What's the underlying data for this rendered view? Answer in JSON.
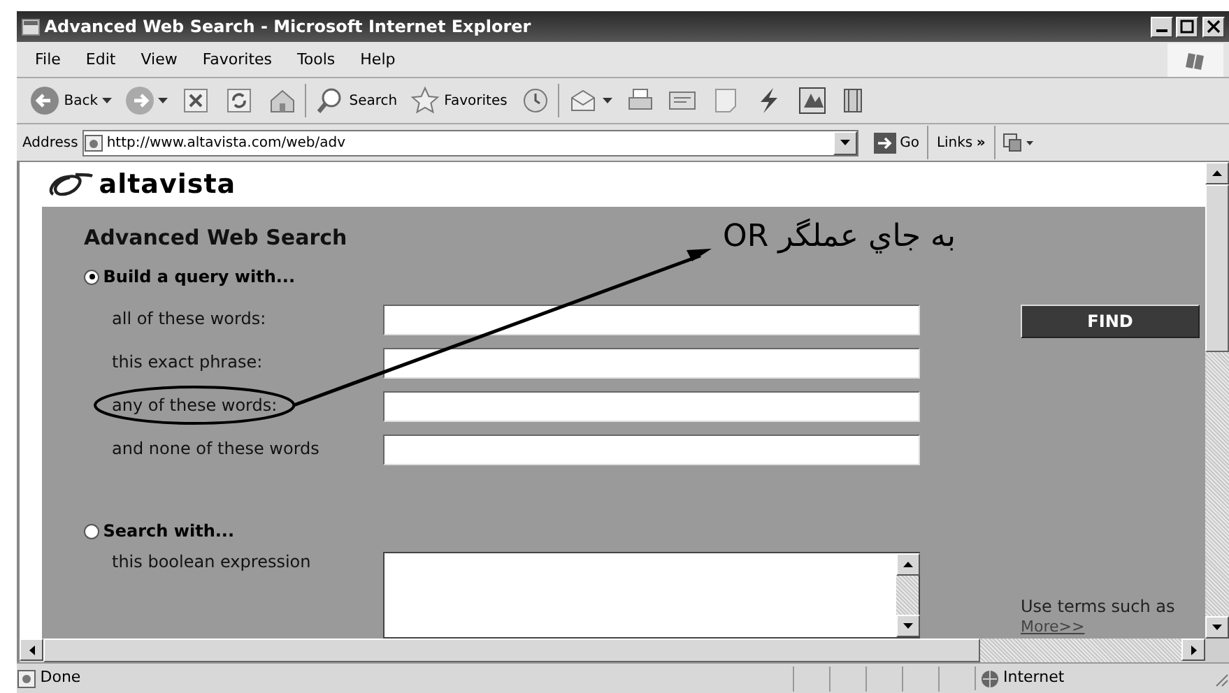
{
  "window": {
    "title": "Advanced Web Search - Microsoft Internet Explorer"
  },
  "menu": [
    "File",
    "Edit",
    "View",
    "Favorites",
    "Tools",
    "Help"
  ],
  "toolbar": [
    {
      "kind": "back",
      "label": "Back"
    },
    {
      "kind": "forward"
    },
    {
      "kind": "stop"
    },
    {
      "kind": "refresh"
    },
    {
      "kind": "home"
    },
    {
      "kind": "search",
      "label": "Search"
    },
    {
      "kind": "favorites",
      "label": "Favorites"
    },
    {
      "kind": "history"
    },
    {
      "kind": "mail"
    },
    {
      "kind": "print"
    },
    {
      "kind": "edit"
    },
    {
      "kind": "discuss"
    },
    {
      "kind": "messenger"
    },
    {
      "kind": "media"
    },
    {
      "kind": "research"
    }
  ],
  "address_bar": {
    "label": "Address",
    "url": "http://www.altavista.com/web/adv",
    "go": "Go",
    "links": "Links",
    "links_more": "»"
  },
  "page": {
    "logo": "altavista",
    "heading": "Advanced Web Search",
    "options": [
      {
        "label": "Build a query with...",
        "selected": true,
        "fields": [
          {
            "label": "all of these words:",
            "circled": false
          },
          {
            "label": "this exact phrase:",
            "circled": false
          },
          {
            "label": "any of these words:",
            "circled": true
          },
          {
            "label": "and none of these words",
            "circled": false
          }
        ]
      },
      {
        "label": "Search with...",
        "selected": false,
        "fields": [
          {
            "label": "this boolean expression",
            "circled": false
          }
        ]
      }
    ],
    "find_button": "FIND",
    "hint": "Use terms such as",
    "more_link": "More>>"
  },
  "annotation": {
    "text": "به جاي عملگر OR"
  },
  "status_bar": {
    "text": "Done",
    "zone": "Internet"
  }
}
